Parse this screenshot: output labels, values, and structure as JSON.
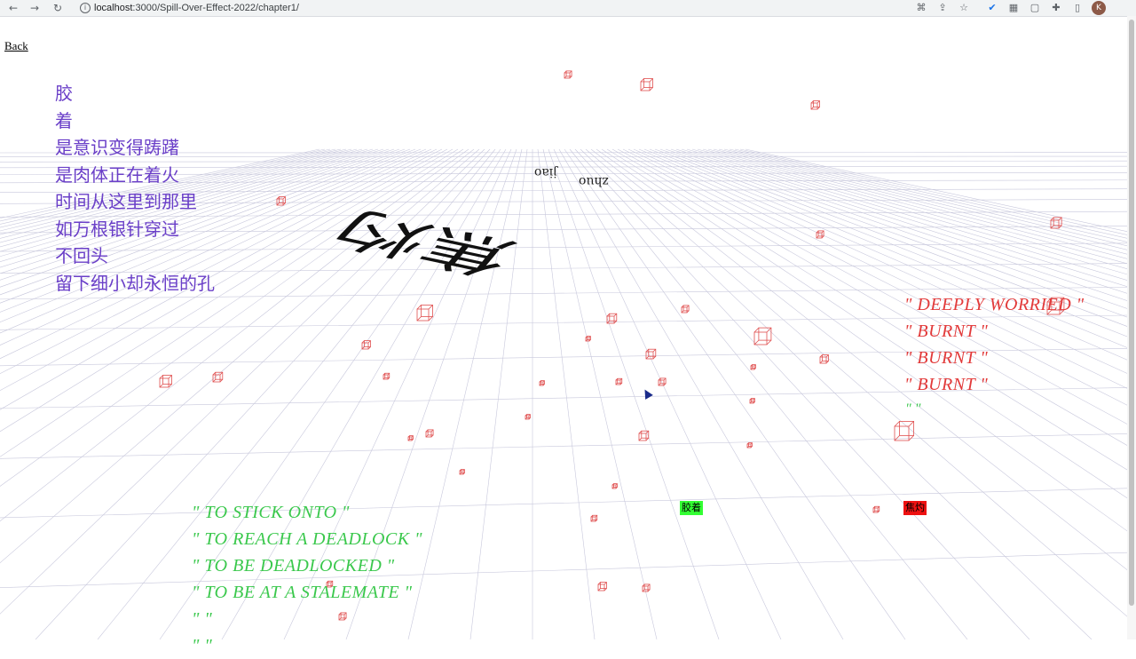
{
  "browser": {
    "url_host": "localhost",
    "url_path": ":3000/Spill-Over-Effect-2022/chapter1/",
    "avatar_letter": "K",
    "back_glyph": "←",
    "forward_glyph": "→",
    "reload_glyph": "↻"
  },
  "page": {
    "back_label": "Back",
    "poem": [
      "胶",
      "着",
      "是意识变得踌躇",
      "是肉体正在着火",
      "时间从这里到那里",
      "如万根银针穿过",
      "不回头",
      "留下细小却永恒的孔"
    ],
    "red_terms": [
      "\" DEEPLY WORRIED \"",
      "\" BURNT \"",
      "\" BURNT \"",
      "\" BURNT \""
    ],
    "green_small": "\"  \"",
    "green_terms": [
      "\" TO STICK ONTO \"",
      "\" TO REACH A DEADLOCK \"",
      "\" TO BE DEADLOCKED \"",
      "\" TO BE AT A STALEMATE \"",
      "\"  \"",
      "\"  \""
    ],
    "badge_green": "胶着",
    "badge_red": "焦灼",
    "big_chars": "焦灼",
    "pinyin_1": "jiao",
    "pinyin_2": "zhuo"
  },
  "colors": {
    "poem": "#6a3fc8",
    "red_terms": "#e23a3a",
    "green_terms": "#3ac84c",
    "grid": "#c8c8dc",
    "cubes": "#e05050"
  }
}
